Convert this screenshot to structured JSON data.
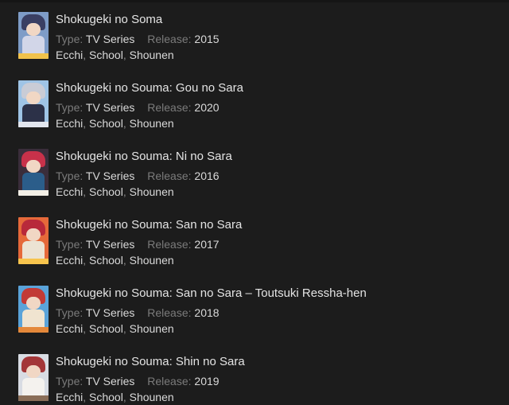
{
  "labels": {
    "type": "Type:",
    "release": "Release:"
  },
  "items": [
    {
      "title": "Shokugeki no Soma",
      "type": "TV Series",
      "release": "2015",
      "genres": [
        "Ecchi",
        "School",
        "Shounen"
      ],
      "poster_colors": {
        "bg": "#7e9cc7",
        "hair": "#3a3f63",
        "body": "#d2d6e8",
        "band": "#f1c24b"
      }
    },
    {
      "title": "Shokugeki no Souma: Gou no Sara",
      "type": "TV Series",
      "release": "2020",
      "genres": [
        "Ecchi",
        "School",
        "Shounen"
      ],
      "poster_colors": {
        "bg": "#9fc4e6",
        "hair": "#c9ccd6",
        "body": "#2c3148",
        "band": "#e2e6ee"
      }
    },
    {
      "title": "Shokugeki no Souma: Ni no Sara",
      "type": "TV Series",
      "release": "2016",
      "genres": [
        "Ecchi",
        "School",
        "Shounen"
      ],
      "poster_colors": {
        "bg": "#3a2d3b",
        "hair": "#c8314a",
        "body": "#2b5d8a",
        "band": "#f3efe6"
      }
    },
    {
      "title": "Shokugeki no Souma: San no Sara",
      "type": "TV Series",
      "release": "2017",
      "genres": [
        "Ecchi",
        "School",
        "Shounen"
      ],
      "poster_colors": {
        "bg": "#e5693a",
        "hair": "#b8293a",
        "body": "#ece3d3",
        "band": "#f7c44d"
      }
    },
    {
      "title": "Shokugeki no Souma: San no Sara – Toutsuki Ressha-hen",
      "type": "TV Series",
      "release": "2018",
      "genres": [
        "Ecchi",
        "School",
        "Shounen"
      ],
      "poster_colors": {
        "bg": "#5aa3d9",
        "hair": "#c23a36",
        "body": "#f0e4d0",
        "band": "#e4883a"
      }
    },
    {
      "title": "Shokugeki no Souma: Shin no Sara",
      "type": "TV Series",
      "release": "2019",
      "genres": [
        "Ecchi",
        "School",
        "Shounen"
      ],
      "poster_colors": {
        "bg": "#d8dce3",
        "hair": "#a33638",
        "body": "#f4f2ee",
        "band": "#8a6e58"
      }
    }
  ]
}
